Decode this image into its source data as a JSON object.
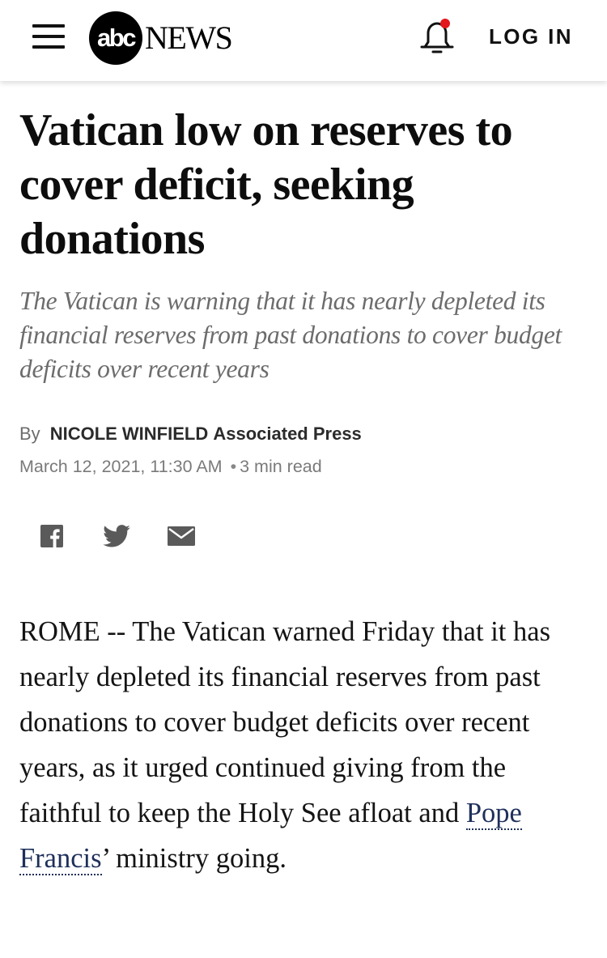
{
  "header": {
    "logo_mark": "abc",
    "logo_word": "NEWS",
    "login_label": "LOG IN",
    "menu_icon": "hamburger-menu-icon",
    "notification_icon": "bell-icon",
    "notification_dot_color": "#e3161d"
  },
  "article": {
    "headline": "Vatican low on reserves to cover deficit, seeking donations",
    "subheadline": "The Vatican is warning that it has nearly depleted its financial reserves from past donations to cover budget deficits over recent years",
    "byline": {
      "prefix": "By",
      "author": "NICOLE WINFIELD",
      "organization": "Associated Press"
    },
    "date": "March 12, 2021, 11:30 AM",
    "read_time": "3 min read",
    "share": [
      "facebook-icon",
      "twitter-icon",
      "email-icon"
    ],
    "body": {
      "text_before_link": "ROME -- The Vatican warned Friday that it has nearly depleted its financial reserves from past donations to cover budget deficits over recent years, as it urged continued giving from the faithful to keep the Holy See afloat and ",
      "link_text": "Pope Francis",
      "text_after_link": "’ ministry going."
    }
  }
}
